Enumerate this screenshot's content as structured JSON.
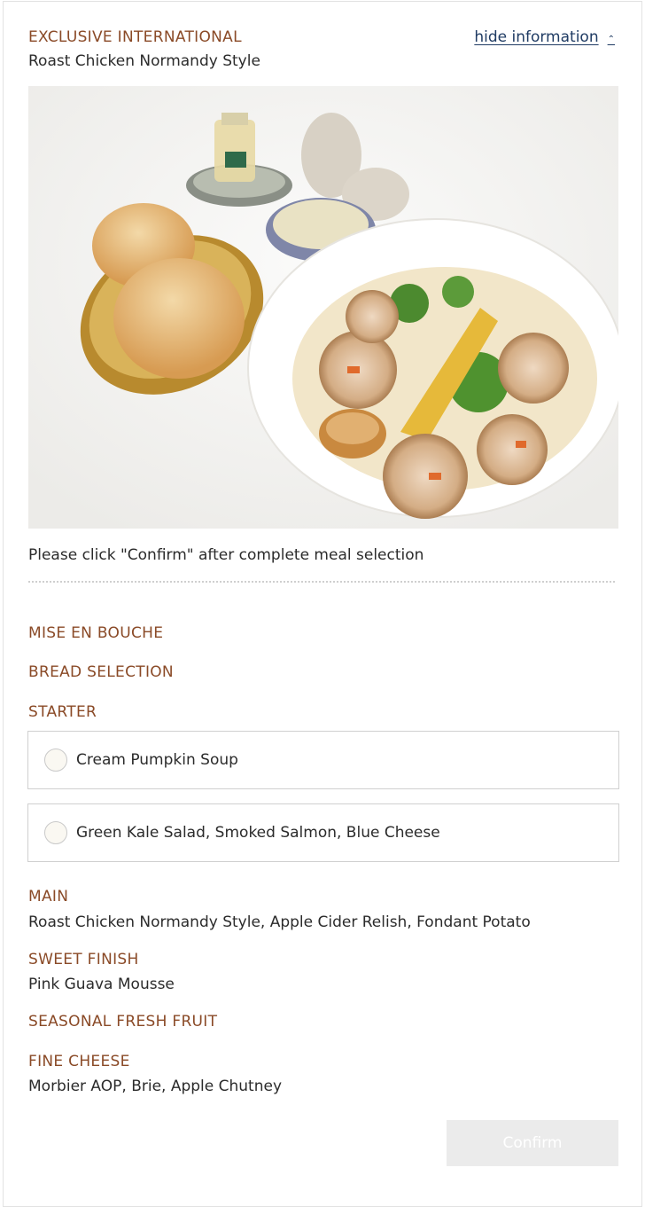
{
  "header": {
    "category": "EXCLUSIVE INTERNATIONAL",
    "dish": "Roast Chicken Normandy Style",
    "hide_link": "hide information"
  },
  "notice": "Please click \"Confirm\" after complete meal selection",
  "sections": {
    "mise_en_bouche": {
      "label": "MISE EN BOUCHE"
    },
    "bread": {
      "label": "BREAD SELECTION"
    },
    "starter": {
      "label": "STARTER",
      "options": [
        {
          "label": "Cream Pumpkin Soup"
        },
        {
          "label": "Green Kale Salad, Smoked Salmon, Blue Cheese"
        }
      ]
    },
    "main": {
      "label": "MAIN",
      "text": "Roast Chicken Normandy Style, Apple Cider Relish, Fondant Potato"
    },
    "sweet": {
      "label": "SWEET FINISH",
      "text": "Pink Guava Mousse"
    },
    "fruit": {
      "label": "SEASONAL FRESH FRUIT"
    },
    "cheese": {
      "label": "FINE CHEESE",
      "text": "Morbier AOP, Brie, Apple Chutney"
    }
  },
  "confirm_label": "Confirm",
  "colors": {
    "accent": "#8a4a27",
    "link": "#1f3b63",
    "button_disabled": "#ebebeb"
  }
}
